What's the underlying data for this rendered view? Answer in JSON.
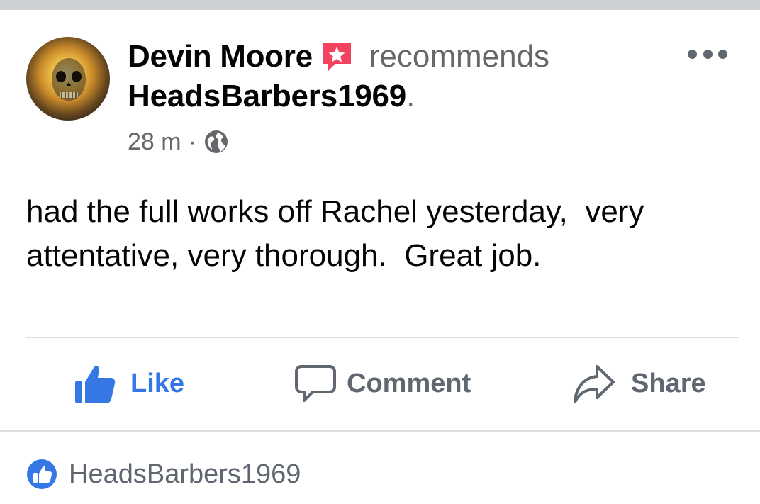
{
  "post": {
    "author": "Devin Moore",
    "action_text": "recommends",
    "page_name": "HeadsBarbers1969",
    "page_suffix": ".",
    "time": "28 m",
    "separator": "·",
    "privacy_icon": "globe-icon",
    "body": "had the full works off Rachel yesterday,  very attentative, very thorough.  Great job."
  },
  "actions": {
    "like": "Like",
    "comment": "Comment",
    "share": "Share"
  },
  "reactions": {
    "icon": "like-reaction-icon",
    "name": "HeadsBarbers1969"
  },
  "colors": {
    "accent": "#3578e5",
    "recommend_badge": "#f3425f",
    "muted": "#65676b",
    "divider": "#dadde1",
    "top_bar": "#ccd0d5"
  }
}
